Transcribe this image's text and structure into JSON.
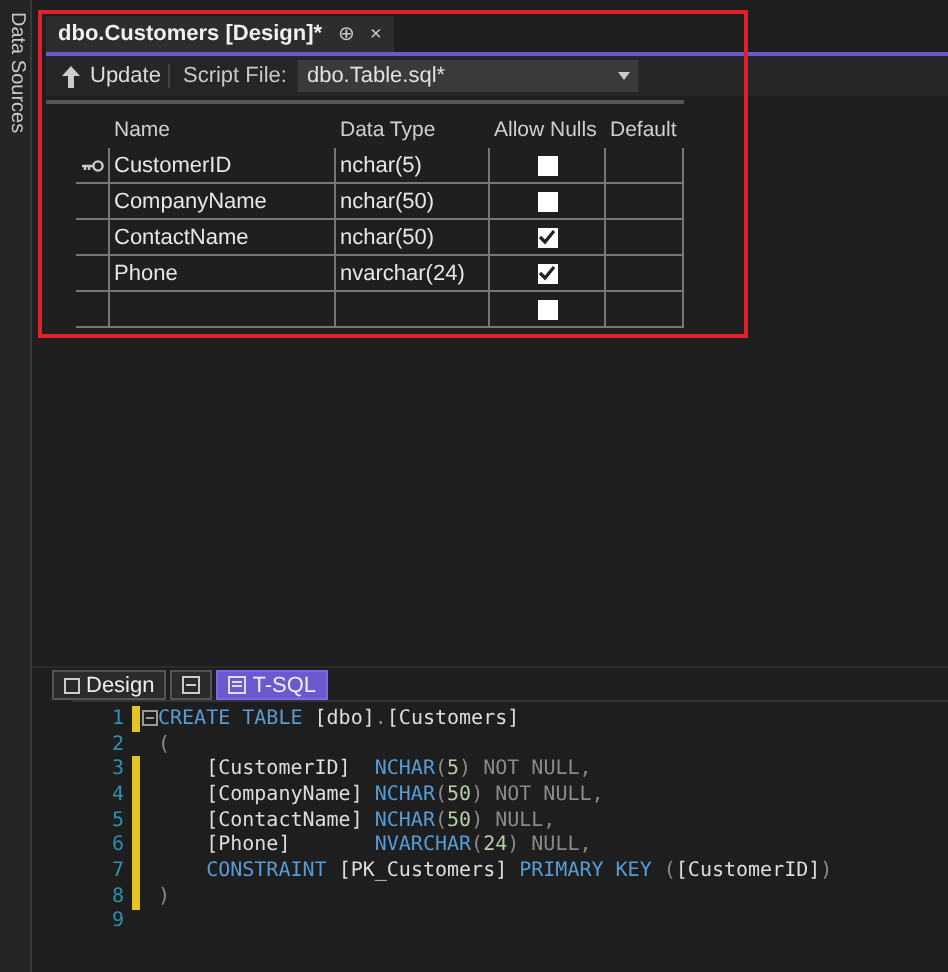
{
  "side_panel": {
    "label": "Data Sources"
  },
  "document_tab": {
    "title": "dbo.Customers [Design]*",
    "pin": "⊕",
    "close": "×"
  },
  "toolbar": {
    "update_label": "Update",
    "script_file_label": "Script File:",
    "script_file_value": "dbo.Table.sql*"
  },
  "table": {
    "columns": [
      "Name",
      "Data Type",
      "Allow Nulls",
      "Default"
    ],
    "rows": [
      {
        "name": "CustomerID",
        "data_type": "nchar(5)",
        "allow_nulls": false,
        "primary_key": true
      },
      {
        "name": "CompanyName",
        "data_type": "nchar(50)",
        "allow_nulls": false,
        "primary_key": false
      },
      {
        "name": "ContactName",
        "data_type": "nchar(50)",
        "allow_nulls": true,
        "primary_key": false
      },
      {
        "name": "Phone",
        "data_type": "nvarchar(24)",
        "allow_nulls": true,
        "primary_key": false
      },
      {
        "name": "",
        "data_type": "",
        "allow_nulls": false,
        "primary_key": false
      }
    ]
  },
  "view_tabs": [
    {
      "kind": "design",
      "label": "Design",
      "selected": false
    },
    {
      "kind": "swap",
      "selected": false
    },
    {
      "kind": "tsql",
      "label": "T-SQL",
      "selected": true
    }
  ],
  "code_lines": [
    {
      "number": "1",
      "changed": true,
      "fold": true,
      "tokens": [
        {
          "kind": "keyword",
          "text": "CREATE TABLE"
        },
        {
          "kind": "plain",
          "text": " [dbo]"
        },
        {
          "kind": "gray",
          "text": "."
        },
        {
          "kind": "plain",
          "text": "[Customers]"
        }
      ]
    },
    {
      "number": "2",
      "changed": false,
      "fold": false,
      "tokens": [
        {
          "kind": "gray",
          "text": "("
        }
      ]
    },
    {
      "number": "3",
      "changed": true,
      "fold": false,
      "tokens": [
        {
          "kind": "plain",
          "text": "    [CustomerID]  "
        },
        {
          "kind": "keyword",
          "text": "NCHAR"
        },
        {
          "kind": "gray",
          "text": "("
        },
        {
          "kind": "number",
          "text": "5"
        },
        {
          "kind": "gray",
          "text": ") NOT NULL,"
        }
      ]
    },
    {
      "number": "4",
      "changed": true,
      "fold": false,
      "tokens": [
        {
          "kind": "plain",
          "text": "    [CompanyName] "
        },
        {
          "kind": "keyword",
          "text": "NCHAR"
        },
        {
          "kind": "gray",
          "text": "("
        },
        {
          "kind": "number",
          "text": "50"
        },
        {
          "kind": "gray",
          "text": ") NOT NULL,"
        }
      ]
    },
    {
      "number": "5",
      "changed": true,
      "fold": false,
      "tokens": [
        {
          "kind": "plain",
          "text": "    [ContactName] "
        },
        {
          "kind": "keyword",
          "text": "NCHAR"
        },
        {
          "kind": "gray",
          "text": "("
        },
        {
          "kind": "number",
          "text": "50"
        },
        {
          "kind": "gray",
          "text": ") NULL,"
        }
      ]
    },
    {
      "number": "6",
      "changed": true,
      "fold": false,
      "tokens": [
        {
          "kind": "plain",
          "text": "    [Phone]       "
        },
        {
          "kind": "keyword",
          "text": "NVARCHAR"
        },
        {
          "kind": "gray",
          "text": "("
        },
        {
          "kind": "number",
          "text": "24"
        },
        {
          "kind": "gray",
          "text": ") NULL,"
        }
      ]
    },
    {
      "number": "7",
      "changed": true,
      "fold": false,
      "tokens": [
        {
          "kind": "keyword",
          "text": "    CONSTRAINT"
        },
        {
          "kind": "plain",
          "text": " [PK_Customers] "
        },
        {
          "kind": "keyword",
          "text": "PRIMARY KEY"
        },
        {
          "kind": "gray",
          "text": " ("
        },
        {
          "kind": "plain",
          "text": "[CustomerID]"
        },
        {
          "kind": "gray",
          "text": ")"
        }
      ]
    },
    {
      "number": "8",
      "changed": true,
      "fold": false,
      "tokens": [
        {
          "kind": "gray",
          "text": ")"
        }
      ]
    },
    {
      "number": "9",
      "changed": false,
      "fold": false
    }
  ]
}
